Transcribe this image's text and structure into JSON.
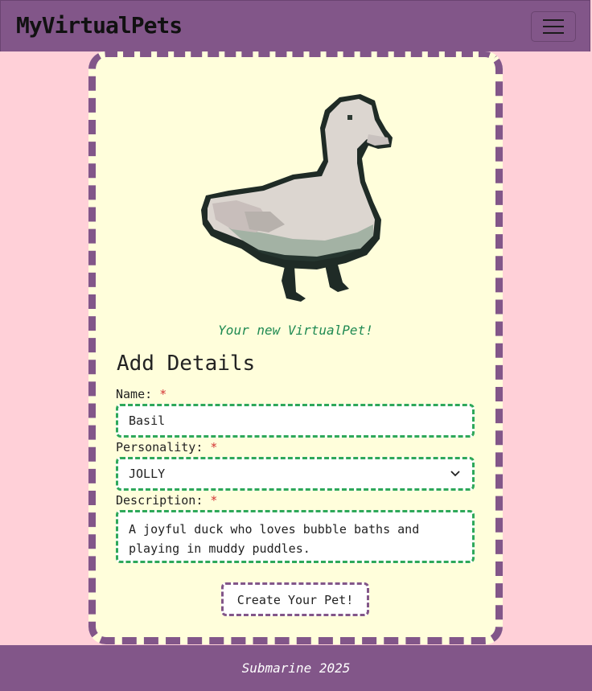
{
  "navbar": {
    "brand": "MyVirtualPets",
    "menu_icon": "hamburger-menu-icon"
  },
  "pet": {
    "image_icon": "pixel-duck-image",
    "caption": "Your new VirtualPet!"
  },
  "form": {
    "heading": "Add Details",
    "name_label": "Name:",
    "name_value": "Basil",
    "personality_label": "Personality:",
    "personality_value": "JOLLY",
    "description_label": "Description:",
    "description_value": "A joyful duck who loves bubble baths and playing in muddy puddles.",
    "required_marker": "*",
    "submit_label": "Create Your Pet!"
  },
  "footer": {
    "text": "Submarine 2025"
  },
  "colors": {
    "page_bg": "#ffd0d8",
    "nav_bg": "#825689",
    "card_bg": "#fffedb",
    "accent_green": "#2ea85a",
    "required_red": "#d43434"
  }
}
